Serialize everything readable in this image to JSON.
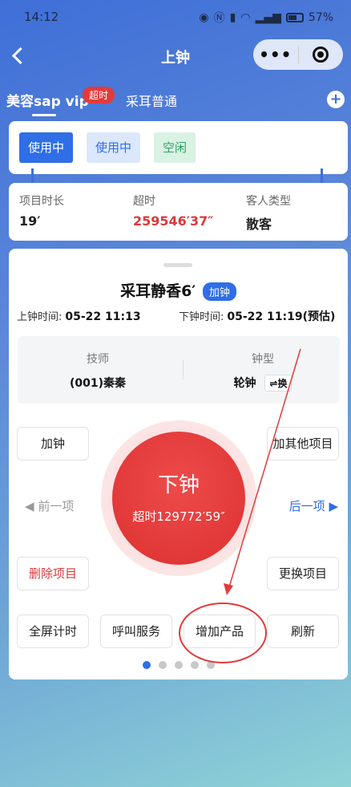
{
  "status_bar": {
    "time": "14:12",
    "icons": [
      "eye-icon",
      "nfc-icon",
      "vibrate-icon",
      "wifi-icon",
      "signal-icon",
      "battery-icon"
    ],
    "battery": "57%"
  },
  "navbar": {
    "title": "上钟",
    "more_label": "•••"
  },
  "tabs": [
    {
      "label": "美容sap vip",
      "badge": "超时"
    },
    {
      "label": "采耳普通"
    }
  ],
  "add_tab_label": "+",
  "status_chips": [
    "使用中",
    "使用中",
    "空闲"
  ],
  "info": {
    "duration_label": "项目时长",
    "duration_value": "19′",
    "overtime_label": "超时",
    "overtime_value": "259546′37″",
    "guest_type_label": "客人类型",
    "guest_type_value": "散客"
  },
  "project": {
    "title": "采耳静香6′",
    "add_badge": "加钟",
    "start_label": "上钟时间:",
    "start_value": "05-22 11:13",
    "end_label": "下钟时间:",
    "end_value": "05-22 11:19(预估)"
  },
  "tech": {
    "tech_label": "技师",
    "tech_value": "(001)秦秦",
    "type_label": "钟型",
    "type_value": "轮钟",
    "swap_label": "⇌换"
  },
  "buttons": {
    "add_clock": "加钟",
    "add_other": "加其他项目",
    "prev": "前一项",
    "next": "后一项",
    "delete": "删除项目",
    "replace": "更换项目",
    "fullscreen": "全屏计时",
    "call_service": "呼叫服务",
    "add_product": "增加产品",
    "refresh": "刷新"
  },
  "main_button": {
    "label": "下钟",
    "sub": "超时129772′59″"
  },
  "pager": {
    "count": 5,
    "active": 0
  },
  "colors": {
    "primary": "#2f6ee6",
    "danger": "#dc3030",
    "success": "#2aa466"
  }
}
